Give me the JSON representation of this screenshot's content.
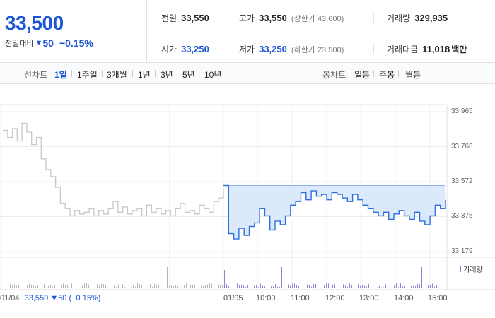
{
  "quote": {
    "price": "33,500",
    "change_label": "전일대비",
    "change_arrow": "▼",
    "change": "50",
    "change_pct": "−0.15%"
  },
  "stats": {
    "prev_close": {
      "label": "전일",
      "value": "33,550"
    },
    "open": {
      "label": "시가",
      "value": "33,250"
    },
    "high": {
      "label": "고가",
      "value": "33,550",
      "note": "(상한가 43,600)"
    },
    "low": {
      "label": "저가",
      "value": "33,250",
      "note": "(하한가 23,500)"
    },
    "volume": {
      "label": "거래량",
      "value": "329,935"
    },
    "amount": {
      "label": "거래대금",
      "value": "11,018",
      "unit": "백만"
    }
  },
  "toolbar": {
    "line_label": "선차트",
    "line_periods": [
      "1일",
      "1주일",
      "3개월",
      "1년",
      "3년",
      "5년",
      "10년"
    ],
    "candle_label": "봉차트",
    "candle_periods": [
      "일봉",
      "주봉",
      "월봉"
    ],
    "active_period": "1일"
  },
  "chart_data": {
    "type": "line",
    "y_ticks": [
      "33,965",
      "33,768",
      "33,572",
      "33,375",
      "33,179"
    ],
    "ylim": [
      33179,
      33965
    ],
    "x_ticks": [
      "01/04",
      "01/05",
      "10:00",
      "11:00",
      "12:00",
      "13:00",
      "14:00",
      "15:00"
    ],
    "prev_day_series": [
      33860,
      33820,
      33870,
      33800,
      33900,
      33850,
      33780,
      33820,
      33700,
      33640,
      33600,
      33540,
      33450,
      33420,
      33380,
      33410,
      33390,
      33400,
      33420,
      33380,
      33410,
      33390,
      33420,
      33460,
      33400,
      33430,
      33390,
      33410,
      33420,
      33380,
      33440,
      33400,
      33420,
      33390,
      33410,
      33380,
      33420,
      33450,
      33400,
      33410,
      33390,
      33440,
      33420,
      33400,
      33460,
      33480,
      33530
    ],
    "today_series": [
      33550,
      33280,
      33250,
      33310,
      33270,
      33320,
      33340,
      33420,
      33380,
      33300,
      33350,
      33330,
      33380,
      33440,
      33460,
      33510,
      33470,
      33520,
      33490,
      33500,
      33470,
      33510,
      33500,
      33480,
      33460,
      33500,
      33470,
      33440,
      33420,
      33400,
      33380,
      33400,
      33360,
      33390,
      33410,
      33380,
      33360,
      33400,
      33350,
      33330,
      33380,
      33440,
      33420,
      33470
    ],
    "base_price": 33550,
    "volume_label": "거래량",
    "info_date": "01/04",
    "info_price": "33,550 ▼50 (−0.15%)"
  },
  "colors": {
    "accent": "#1a56d6",
    "today_line": "#2e6fe0",
    "today_fill": "#dce9fb",
    "prev_line": "#c8c8c8",
    "volume": "#9b7fd6"
  }
}
